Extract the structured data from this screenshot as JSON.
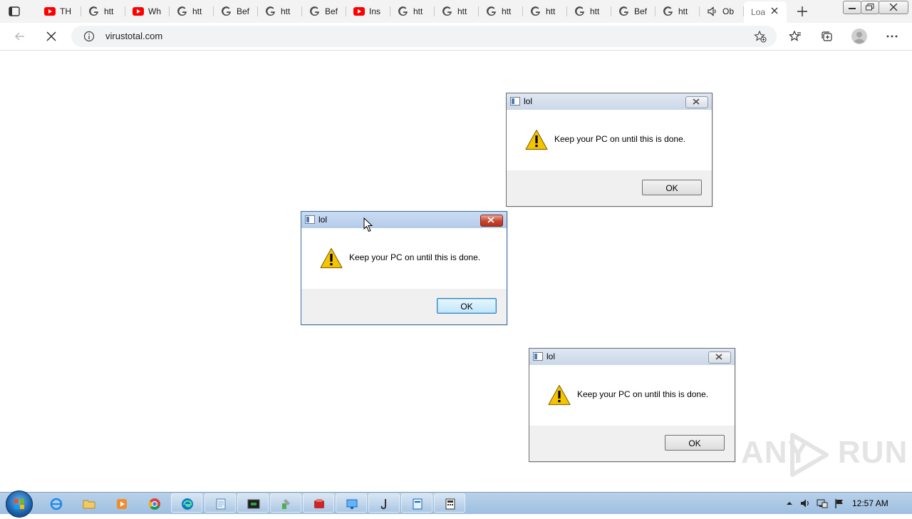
{
  "browser": {
    "tabs": [
      {
        "icon": "youtube-icon",
        "title": "TH"
      },
      {
        "icon": "google-icon",
        "title": "htt"
      },
      {
        "icon": "youtube-icon",
        "title": "Wh"
      },
      {
        "icon": "google-icon",
        "title": "htt"
      },
      {
        "icon": "google-icon",
        "title": "Bef"
      },
      {
        "icon": "google-icon",
        "title": "htt"
      },
      {
        "icon": "google-icon",
        "title": "Bef"
      },
      {
        "icon": "youtube-icon",
        "title": "Ins"
      },
      {
        "icon": "google-icon",
        "title": "htt"
      },
      {
        "icon": "google-icon",
        "title": "htt"
      },
      {
        "icon": "google-icon",
        "title": "htt"
      },
      {
        "icon": "google-icon",
        "title": "htt"
      },
      {
        "icon": "google-icon",
        "title": "htt"
      },
      {
        "icon": "google-icon",
        "title": "Bef"
      },
      {
        "icon": "google-icon",
        "title": "htt"
      },
      {
        "icon": "speaker-icon",
        "title": "Ob"
      },
      {
        "icon": "loading",
        "title": "Loa",
        "active": true
      }
    ],
    "address": {
      "url": "virustotal.com"
    }
  },
  "dialogs": [
    {
      "title": "lol",
      "message": "Keep your PC on until this is done.",
      "ok_label": "OK",
      "focused": false
    },
    {
      "title": "lol",
      "message": "Keep your PC on until this is done.",
      "ok_label": "OK",
      "focused": true
    },
    {
      "title": "lol",
      "message": "Keep your PC on until this is done.",
      "ok_label": "OK",
      "focused": false
    }
  ],
  "watermark": {
    "left": "ANY",
    "right": "RUN"
  },
  "taskbar": {
    "clock": "12:57 AM"
  },
  "colors": {
    "youtube_red": "#ff0000",
    "taskbar_blue": "#b9d1ea",
    "focused_border": "#3a6ea5",
    "close_red": "#c7442d",
    "warning_yellow": "#f5c400"
  }
}
